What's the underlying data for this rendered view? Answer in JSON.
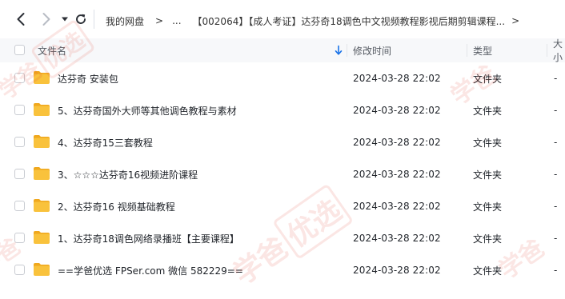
{
  "nav": {
    "breadcrumb": [
      "我的网盘",
      "...",
      "【002064】【成人考证】达芬奇18调色中文视频教程影视后期剪辑课程..."
    ],
    "separator": ">"
  },
  "table": {
    "columns": {
      "name": "文件名",
      "modified": "修改时间",
      "type": "类型",
      "size": "大小"
    },
    "rows": [
      {
        "name": "达芬奇 安装包",
        "modified": "2024-03-28 22:02",
        "type": "文件夹",
        "size": "-"
      },
      {
        "name": "5、达芬奇国外大师等其他调色教程与素材",
        "modified": "2024-03-28 22:02",
        "type": "文件夹",
        "size": "-"
      },
      {
        "name": "4、达芬奇15三套教程",
        "modified": "2024-03-28 22:02",
        "type": "文件夹",
        "size": "-"
      },
      {
        "name": "3、☆☆☆达芬奇16视频进阶课程",
        "modified": "2024-03-28 22:02",
        "type": "文件夹",
        "size": "-"
      },
      {
        "name": "2、达芬奇16 视频基础教程",
        "modified": "2024-03-28 22:02",
        "type": "文件夹",
        "size": "-"
      },
      {
        "name": "1、达芬奇18调色网络录播班【主要课程】",
        "modified": "2024-03-28 22:02",
        "type": "文件夹",
        "size": "-"
      },
      {
        "name": "==学爸优选 FPSer.com 微信 582229==",
        "modified": "2024-03-28 22:02",
        "type": "文件夹",
        "size": "-"
      }
    ]
  },
  "watermark": {
    "text": "学爸",
    "boxed": "优选"
  },
  "colors": {
    "accent": "#1a73e8",
    "folder": "#f9c23c",
    "folder_back": "#f0a81e",
    "header_bg": "#f7f8fa",
    "watermark": "#e23c32"
  }
}
